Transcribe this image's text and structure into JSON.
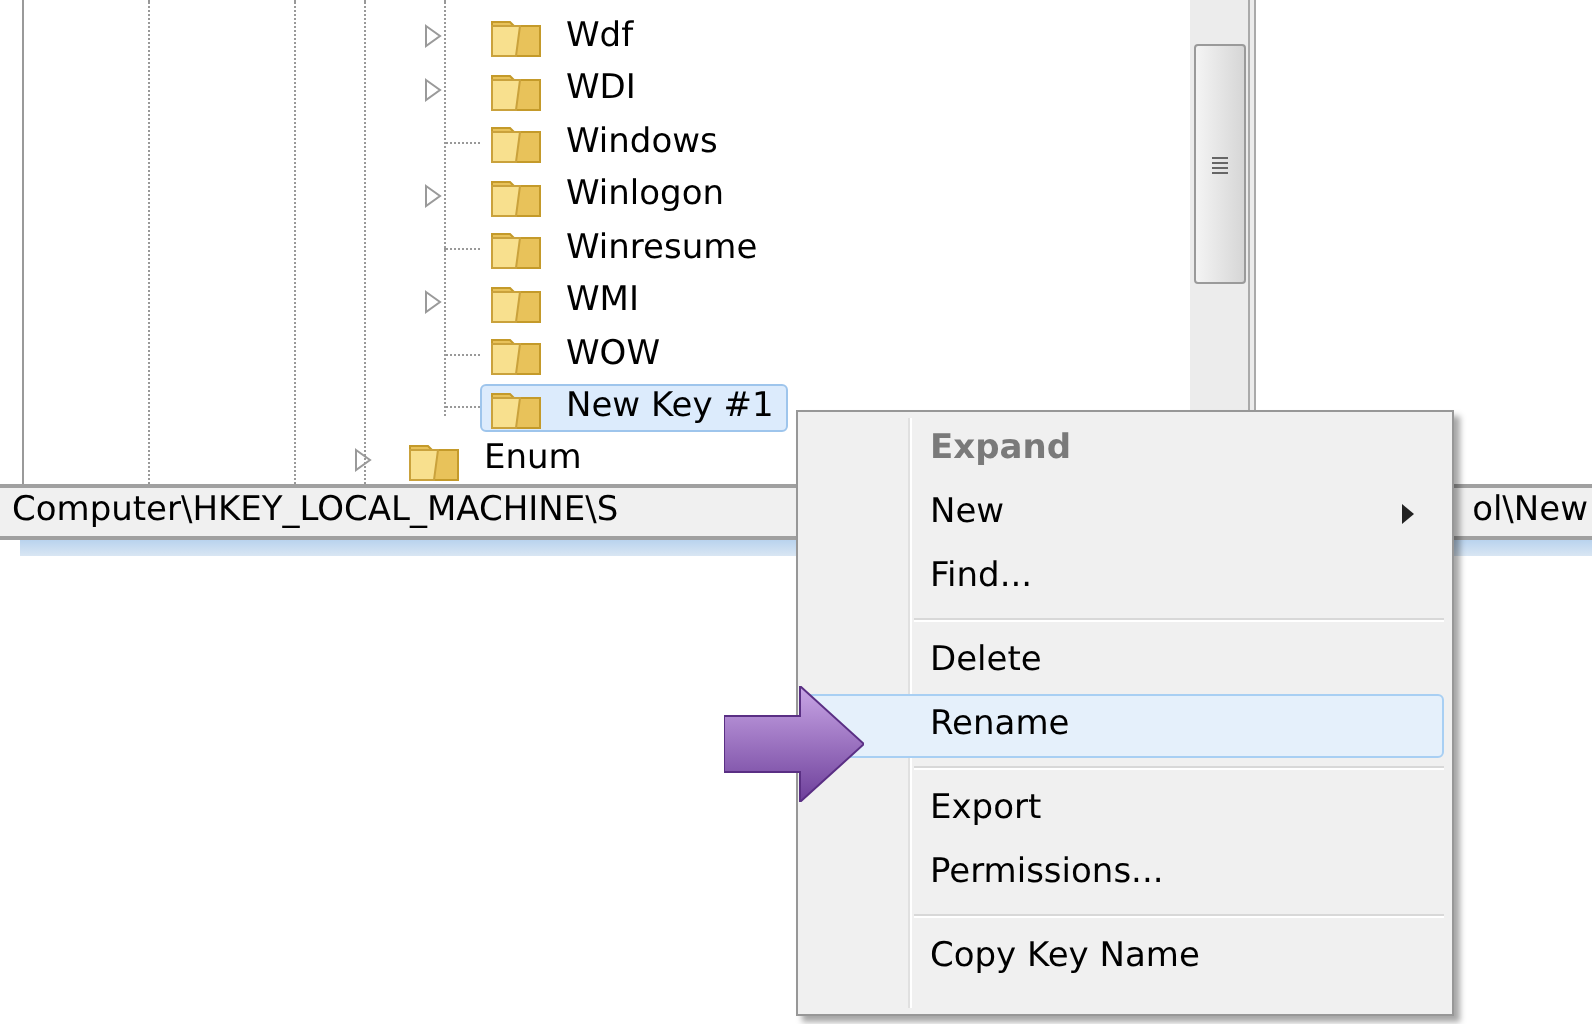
{
  "tree": {
    "items": [
      {
        "label": "Wdf",
        "expandable": true,
        "selected": false
      },
      {
        "label": "WDI",
        "expandable": true,
        "selected": false
      },
      {
        "label": "Windows",
        "expandable": false,
        "selected": false
      },
      {
        "label": "Winlogon",
        "expandable": true,
        "selected": false
      },
      {
        "label": "Winresume",
        "expandable": false,
        "selected": false
      },
      {
        "label": "WMI",
        "expandable": true,
        "selected": false
      },
      {
        "label": "WOW",
        "expandable": false,
        "selected": false
      },
      {
        "label": "New Key #1",
        "expandable": false,
        "selected": true
      }
    ],
    "sibling": {
      "label": "Enum",
      "expandable": true
    }
  },
  "status_bar": {
    "path_start": "Computer\\HKEY_LOCAL_MACHINE\\S",
    "path_end": "ol\\New"
  },
  "context_menu": {
    "items": [
      {
        "kind": "item",
        "label": "Expand",
        "disabled": true,
        "selected": false,
        "submenu": false
      },
      {
        "kind": "item",
        "label": "New",
        "disabled": false,
        "selected": false,
        "submenu": true
      },
      {
        "kind": "item",
        "label": "Find...",
        "disabled": false,
        "selected": false,
        "submenu": false
      },
      {
        "kind": "separator"
      },
      {
        "kind": "item",
        "label": "Delete",
        "disabled": false,
        "selected": false,
        "submenu": false
      },
      {
        "kind": "item",
        "label": "Rename",
        "disabled": false,
        "selected": true,
        "submenu": false
      },
      {
        "kind": "separator"
      },
      {
        "kind": "item",
        "label": "Export",
        "disabled": false,
        "selected": false,
        "submenu": false
      },
      {
        "kind": "item",
        "label": "Permissions...",
        "disabled": false,
        "selected": false,
        "submenu": false
      },
      {
        "kind": "separator"
      },
      {
        "kind": "item",
        "label": "Copy Key Name",
        "disabled": false,
        "selected": false,
        "submenu": false
      }
    ]
  }
}
